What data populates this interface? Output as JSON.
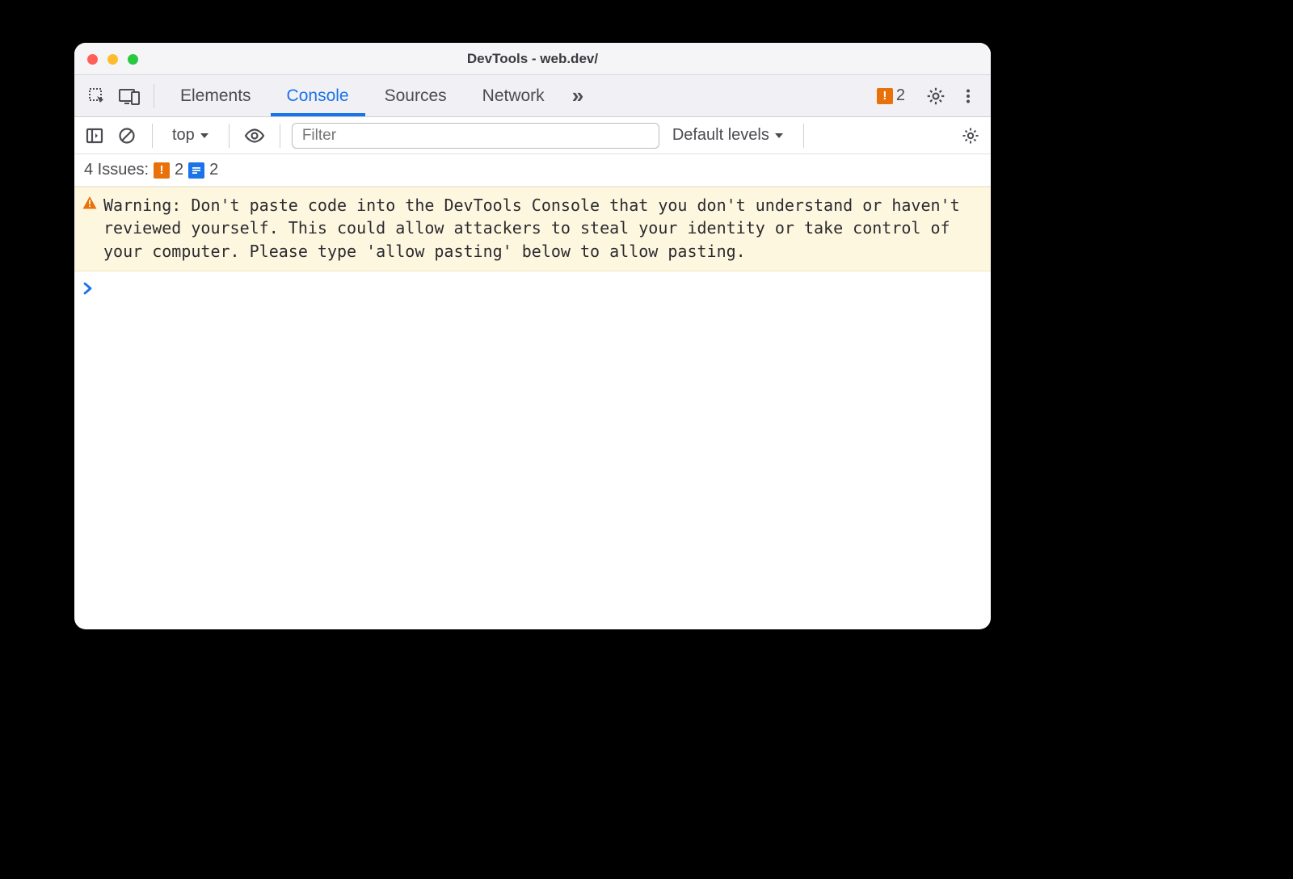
{
  "window": {
    "title": "DevTools - web.dev/"
  },
  "tabs": {
    "items": [
      "Elements",
      "Console",
      "Sources",
      "Network"
    ],
    "active_index": 1,
    "overflow_glyph": "»"
  },
  "tabstrip_right": {
    "error_count": "2"
  },
  "console_toolbar": {
    "context_label": "top",
    "filter_placeholder": "Filter",
    "levels_label": "Default levels"
  },
  "issues": {
    "prefix": "4 Issues:",
    "error_count": "2",
    "info_count": "2"
  },
  "warning": {
    "label": "Warning:",
    "body": "Don't paste code into the DevTools Console that you don't understand or haven't reviewed yourself. This could allow attackers to steal your identity or take control of your computer. Please type 'allow pasting' below to allow pasting."
  }
}
